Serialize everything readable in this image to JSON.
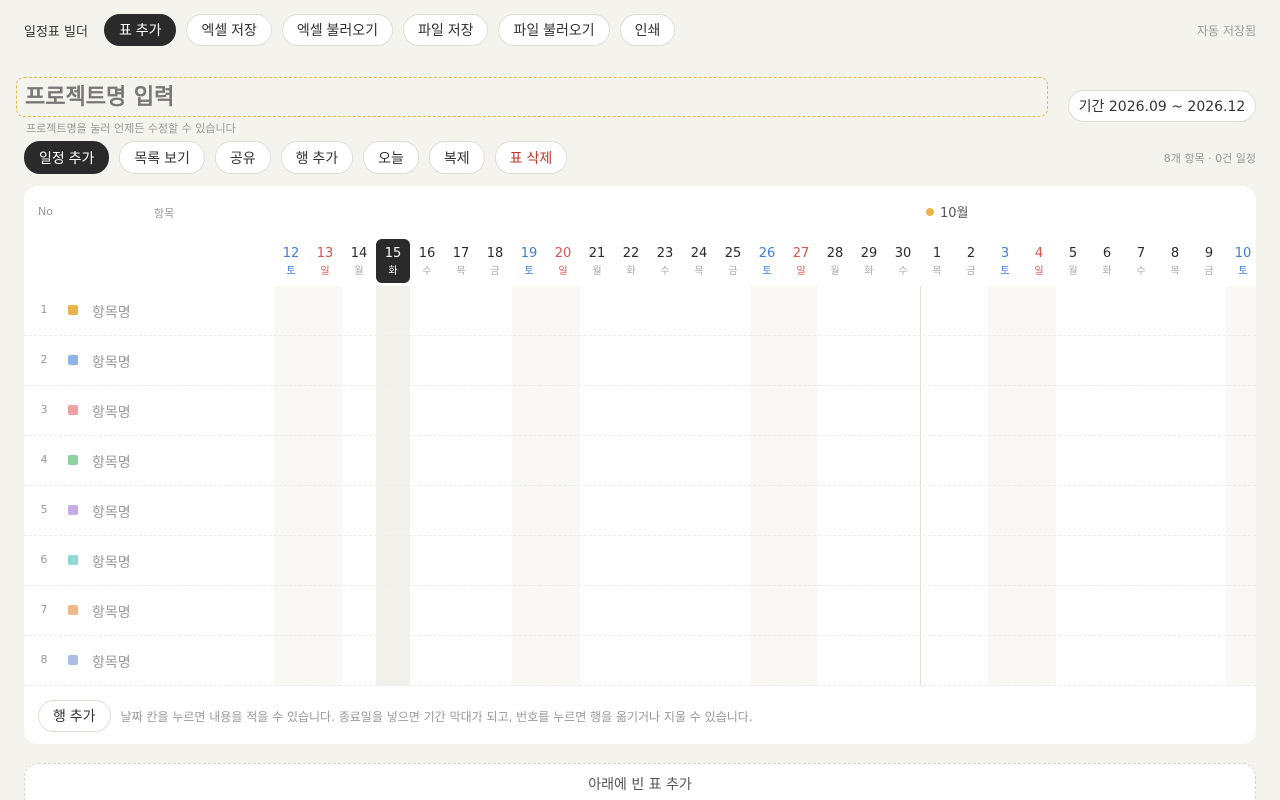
{
  "app": {
    "title": "일정표 빌더",
    "autosave": "자동 저장됨"
  },
  "toolbar": {
    "buttons": [
      "표 추가",
      "엑셀 저장",
      "엑셀 불러오기",
      "파일 저장",
      "파일 불러오기",
      "인쇄"
    ]
  },
  "project": {
    "placeholder": "프로젝트명 입력",
    "hint": "프로젝트명을 눌러 언제든 수정할 수 있습니다",
    "period": "기간 2026.09 ~ 2026.12"
  },
  "toolbar2": {
    "buttons": [
      "일정 추가",
      "목록 보기",
      "공유",
      "행 추가",
      "오늘",
      "복제",
      "표 삭제"
    ],
    "counts": "8개 항목 · 0건 일정"
  },
  "table": {
    "header_no": "No",
    "header_item": "항목",
    "month": {
      "label": "10월",
      "color": "#e8b54a"
    },
    "days": [
      {
        "d": "12",
        "w": "토",
        "type": "sat"
      },
      {
        "d": "13",
        "w": "일",
        "type": "sun"
      },
      {
        "d": "14",
        "w": "월",
        "type": ""
      },
      {
        "d": "15",
        "w": "화",
        "type": "today"
      },
      {
        "d": "16",
        "w": "수",
        "type": ""
      },
      {
        "d": "17",
        "w": "목",
        "type": ""
      },
      {
        "d": "18",
        "w": "금",
        "type": ""
      },
      {
        "d": "19",
        "w": "토",
        "type": "sat"
      },
      {
        "d": "20",
        "w": "일",
        "type": "sun"
      },
      {
        "d": "21",
        "w": "월",
        "type": ""
      },
      {
        "d": "22",
        "w": "화",
        "type": ""
      },
      {
        "d": "23",
        "w": "수",
        "type": ""
      },
      {
        "d": "24",
        "w": "목",
        "type": ""
      },
      {
        "d": "25",
        "w": "금",
        "type": ""
      },
      {
        "d": "26",
        "w": "토",
        "type": "sat"
      },
      {
        "d": "27",
        "w": "일",
        "type": "sun"
      },
      {
        "d": "28",
        "w": "월",
        "type": ""
      },
      {
        "d": "29",
        "w": "화",
        "type": ""
      },
      {
        "d": "30",
        "w": "수",
        "type": ""
      },
      {
        "d": "1",
        "w": "목",
        "type": ""
      },
      {
        "d": "2",
        "w": "금",
        "type": ""
      },
      {
        "d": "3",
        "w": "토",
        "type": "sat"
      },
      {
        "d": "4",
        "w": "일",
        "type": "sun"
      },
      {
        "d": "5",
        "w": "월",
        "type": ""
      },
      {
        "d": "6",
        "w": "화",
        "type": ""
      },
      {
        "d": "7",
        "w": "수",
        "type": ""
      },
      {
        "d": "8",
        "w": "목",
        "type": ""
      },
      {
        "d": "9",
        "w": "금",
        "type": ""
      },
      {
        "d": "10",
        "w": "토",
        "type": "sat"
      }
    ],
    "rows": [
      {
        "no": "1",
        "name": "항목명",
        "color": "#e8b54a"
      },
      {
        "no": "2",
        "name": "항목명",
        "color": "#8fb4e8"
      },
      {
        "no": "3",
        "name": "항목명",
        "color": "#eda3a3"
      },
      {
        "no": "4",
        "name": "항목명",
        "color": "#8fd3a3"
      },
      {
        "no": "5",
        "name": "항목명",
        "color": "#c7ade8"
      },
      {
        "no": "6",
        "name": "항목명",
        "color": "#93d6d3"
      },
      {
        "no": "7",
        "name": "항목명",
        "color": "#f0b98a"
      },
      {
        "no": "8",
        "name": "항목명",
        "color": "#a9bde6"
      }
    ],
    "footer_button": "행 추가",
    "footer_hint": "날짜 칸을 누르면 내용을 적을 수 있습니다. 종료일을 넣으면 기간 막대가 되고, 번호를 누르면 행을 옮기거나 지울 수 있습니다."
  },
  "add_table": "아래에 빈 표 추가"
}
